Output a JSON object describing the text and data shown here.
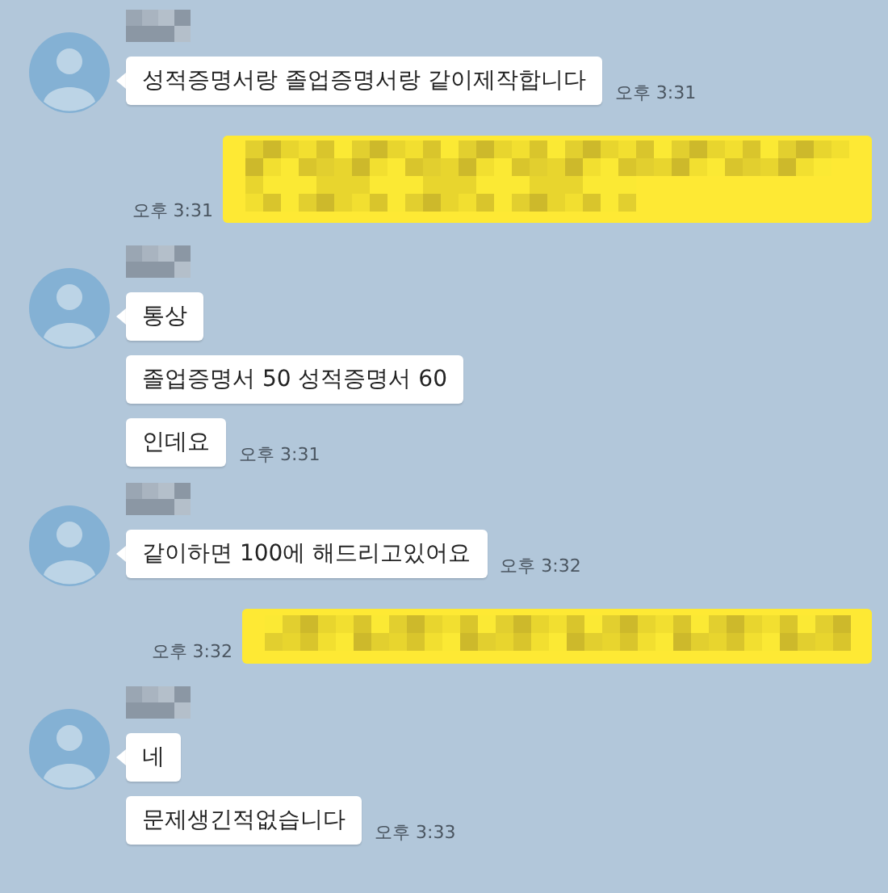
{
  "messages": [
    {
      "kind": "received",
      "bubbles": [
        "성적증명서랑 졸업증명서랑 같이제작합니다"
      ],
      "time": "오후 3:31"
    },
    {
      "kind": "sent",
      "time": "오후 3:31"
    },
    {
      "kind": "received",
      "bubbles": [
        "통상",
        "졸업증명서 50 성적증명서 60",
        "인데요"
      ],
      "time": "오후 3:31"
    },
    {
      "kind": "received",
      "bubbles": [
        "같이하면 100에 해드리고있어요"
      ],
      "time": "오후 3:32"
    },
    {
      "kind": "sent",
      "time": "오후 3:32"
    },
    {
      "kind": "received",
      "bubbles": [
        "네",
        "문제생긴적없습니다"
      ],
      "time": "오후 3:33"
    }
  ]
}
